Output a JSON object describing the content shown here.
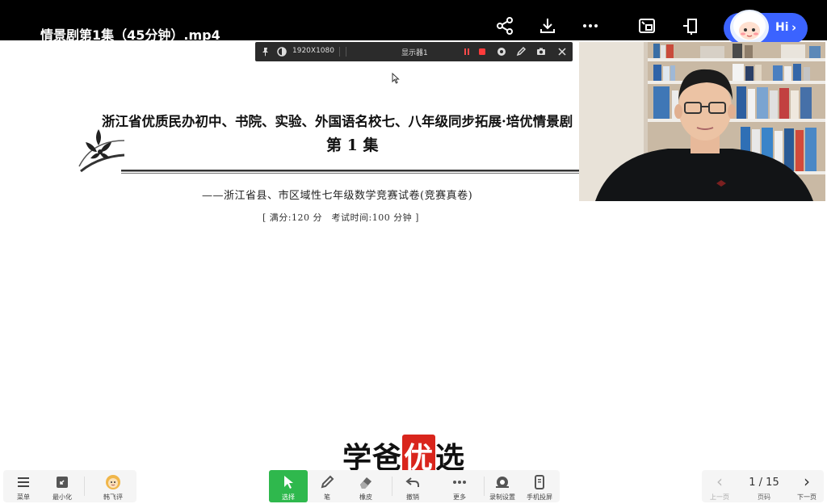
{
  "player": {
    "title": "情景剧第1集（45分钟）.mp4",
    "assistant_greeting": "Hi",
    "assistant_arrow": "›"
  },
  "recorder_toolbar": {
    "resolution": "1920X1080",
    "display": "显示器1"
  },
  "slide": {
    "heading": "浙江省优质民办初中、书院、实验、外国语名校七、八年级同步拓展·培优情景剧",
    "episode": "第 1 集",
    "subtitle": "——浙江省县、市区域性七年级数学竞赛试卷(竞赛真卷)",
    "meta": "[ 满分:120 分　考试时间:100 分钟 ]"
  },
  "watermark": {
    "part1": "学爸",
    "part2": "优",
    "part3": "选"
  },
  "bottom_left": {
    "menu": "菜单",
    "minimize": "最小化",
    "user": "韩飞评"
  },
  "bottom_tools": {
    "select": "选择",
    "pen": "笔",
    "eraser": "橡皮",
    "undo": "撤销",
    "more": "更多",
    "record_settings": "录制设置",
    "phone_cast": "手机投屏"
  },
  "pagination": {
    "indicator": "1 / 15",
    "current": 1,
    "total": 15,
    "prev": "上一页",
    "page_label": "页码",
    "next": "下一页"
  },
  "colors": {
    "accent_green": "#2fb84d",
    "assistant_blue": "#3b63ff",
    "watermark_red": "#d9251c"
  }
}
